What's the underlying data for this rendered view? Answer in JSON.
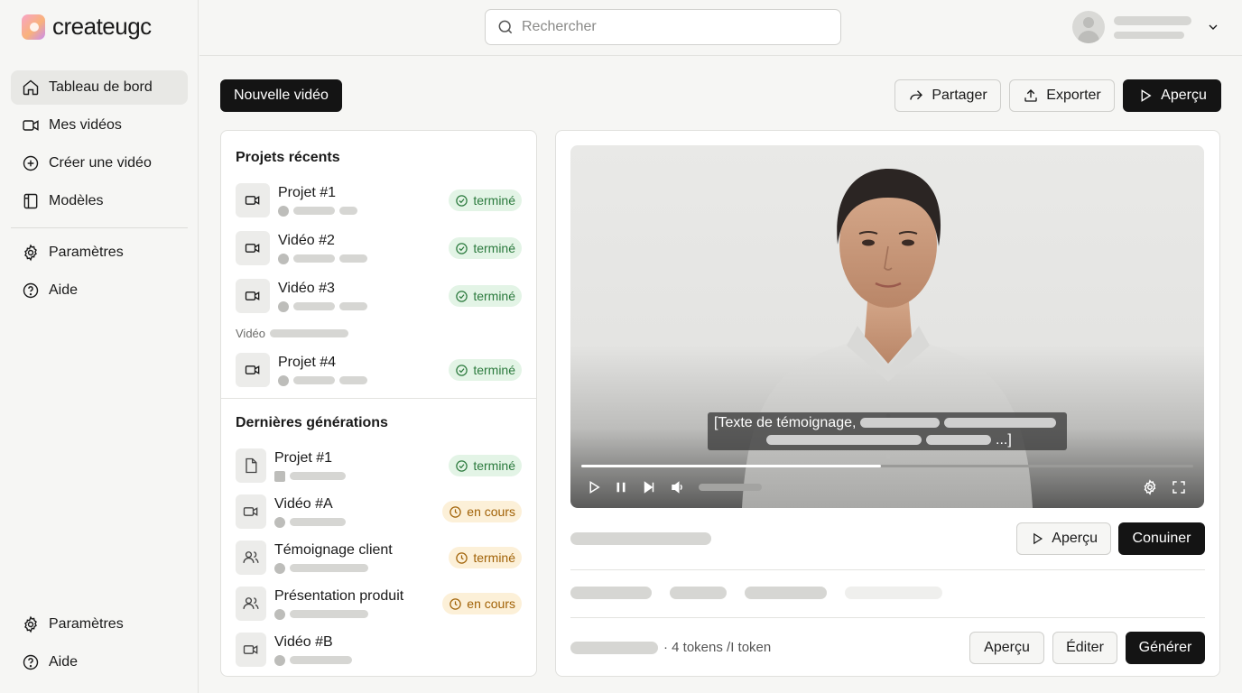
{
  "app": {
    "logo_text": "createugc"
  },
  "sidebar": {
    "items": [
      {
        "label": "Tableau de bord",
        "icon": "home-icon",
        "active": true
      },
      {
        "label": "Mes vidéos",
        "icon": "video-icon"
      },
      {
        "label": "Créer une vidéo",
        "icon": "plus-circle-icon"
      },
      {
        "label": "Modèles",
        "icon": "templates-icon"
      }
    ],
    "secondary": [
      {
        "label": "Paramètres",
        "icon": "gear-icon"
      },
      {
        "label": "Aide",
        "icon": "help-icon"
      }
    ],
    "footer": [
      {
        "label": "Paramètres",
        "icon": "gear-icon"
      },
      {
        "label": "Aide",
        "icon": "help-icon"
      }
    ]
  },
  "search": {
    "placeholder": "Rechercher"
  },
  "toolbar": {
    "new_video": "Nouvelle vidéo",
    "share": "Partager",
    "export": "Exporter",
    "preview": "Aperçu"
  },
  "recent": {
    "title": "Projets récents",
    "items": [
      {
        "title": "Projet #1",
        "status": "terminé"
      },
      {
        "title": "Vidéo #2",
        "status": "terminé"
      },
      {
        "title": "Vidéo #3",
        "status": "terminé"
      }
    ],
    "group_label": "Vidéo",
    "group_items": [
      {
        "title": "Projet #4",
        "status": "terminé"
      }
    ]
  },
  "generations": {
    "title": "Dernières générations",
    "items": [
      {
        "title": "Projet #1",
        "status": "terminé",
        "icon": "file-icon",
        "kind": "done"
      },
      {
        "title": "Vidéo #A",
        "status": "en cours",
        "icon": "video-icon",
        "kind": "wip"
      },
      {
        "title": "Témoignage client",
        "status": "terminé",
        "icon": "users-icon",
        "kind": "wip"
      },
      {
        "title": "Présentation produit",
        "status": "en cours",
        "icon": "users-icon",
        "kind": "wip"
      },
      {
        "title": "Vidéo #B",
        "status": "",
        "icon": "video-icon",
        "kind": "none"
      }
    ]
  },
  "player": {
    "caption_start": "[Texte de témoignage,",
    "caption_end": "...]",
    "progress": 0.49
  },
  "editor": {
    "preview": "Aperçu",
    "continue": "Conuiner",
    "tokens_text": "· 4 tokens /I token",
    "footer_preview": "Aperçu",
    "edit": "Éditer",
    "generate": "Générer"
  },
  "colors": {
    "accent": "#141414",
    "done_bg": "#e3f4e6",
    "done_fg": "#2b7a3d",
    "wip_bg": "#fcf0d8",
    "wip_fg": "#a16207"
  }
}
